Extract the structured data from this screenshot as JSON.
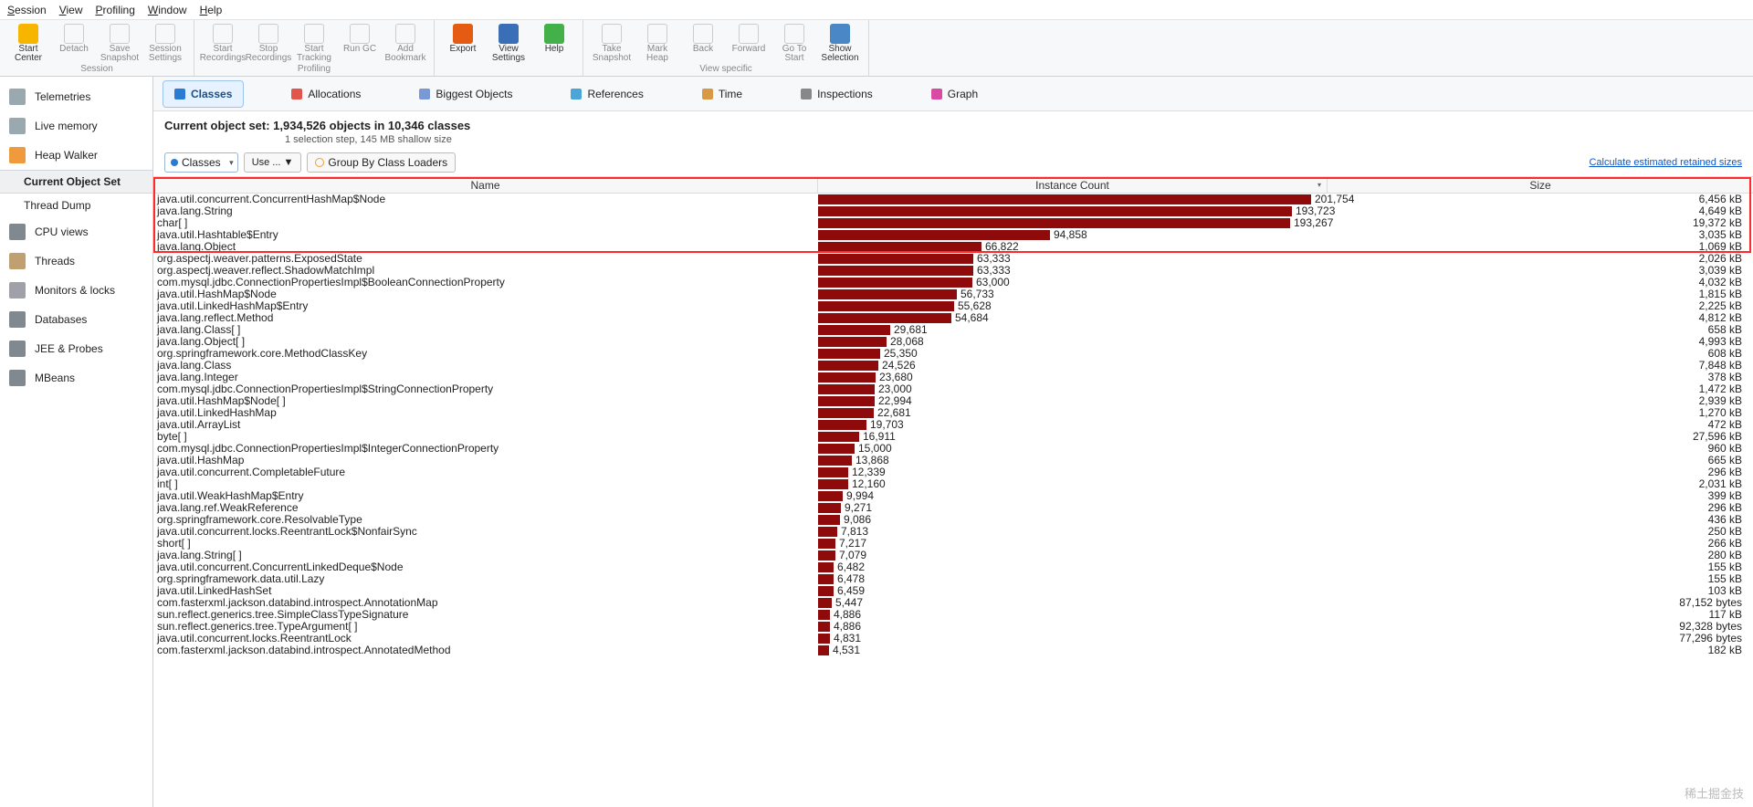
{
  "menu": [
    "Session",
    "View",
    "Profiling",
    "Window",
    "Help"
  ],
  "toolbar_groups": [
    {
      "label": "Session",
      "items": [
        {
          "label": "Start\nCenter",
          "enabled": true,
          "color": "#f7b500"
        },
        {
          "label": "Detach",
          "enabled": false
        },
        {
          "label": "Save\nSnapshot",
          "enabled": false
        },
        {
          "label": "Session\nSettings",
          "enabled": false
        }
      ]
    },
    {
      "label": "Profiling",
      "items": [
        {
          "label": "Start\nRecordings",
          "enabled": false
        },
        {
          "label": "Stop\nRecordings",
          "enabled": false
        },
        {
          "label": "Start\nTracking",
          "enabled": false
        },
        {
          "label": "Run GC",
          "enabled": false
        },
        {
          "label": "Add\nBookmark",
          "enabled": false
        }
      ]
    },
    {
      "label": "",
      "items": [
        {
          "label": "Export",
          "enabled": true,
          "color": "#e55b13"
        },
        {
          "label": "View\nSettings",
          "enabled": true,
          "color": "#3a6fb7"
        },
        {
          "label": "Help",
          "enabled": true,
          "color": "#44b04a"
        }
      ]
    },
    {
      "label": "View specific",
      "items": [
        {
          "label": "Take\nSnapshot",
          "enabled": false
        },
        {
          "label": "Mark\nHeap",
          "enabled": false
        },
        {
          "label": "Back",
          "enabled": false
        },
        {
          "label": "Forward",
          "enabled": false
        },
        {
          "label": "Go To\nStart",
          "enabled": false
        },
        {
          "label": "Show\nSelection",
          "enabled": true,
          "color": "#4987c7"
        }
      ]
    }
  ],
  "sidebar": [
    {
      "label": "Telemetries",
      "ic": "#9aa8b0"
    },
    {
      "label": "Live memory",
      "ic": "#9aa8b0"
    },
    {
      "label": "Heap Walker",
      "ic": "#f09a3e"
    },
    {
      "label": "Current Object Set",
      "sub": true,
      "sel": true
    },
    {
      "label": "Thread Dump",
      "sub": true
    },
    {
      "label": "CPU views",
      "ic": "#808890"
    },
    {
      "label": "Threads",
      "ic": "#c0a070"
    },
    {
      "label": "Monitors & locks",
      "ic": "#a0a0a8"
    },
    {
      "label": "Databases",
      "ic": "#808890"
    },
    {
      "label": "JEE & Probes",
      "ic": "#808890"
    },
    {
      "label": "MBeans",
      "ic": "#808890"
    }
  ],
  "tabs": [
    {
      "label": "Classes",
      "sel": true,
      "color": "#2a7bd4"
    },
    {
      "label": "Allocations",
      "color": "#e2554d"
    },
    {
      "label": "Biggest Objects",
      "color": "#7a97d6"
    },
    {
      "label": "References",
      "color": "#4aa6d6"
    },
    {
      "label": "Time",
      "color": "#d69a45"
    },
    {
      "label": "Inspections",
      "color": "#888"
    },
    {
      "label": "Graph",
      "color": "#d94aa2"
    }
  ],
  "header": {
    "title": "Current object set:  1,934,526 objects in 10,346 classes",
    "sub": "1 selection step, 145 MB shallow size"
  },
  "controls": {
    "combo1": "Classes",
    "btn1": "Use ... ▼",
    "btn2": "Group By Class Loaders",
    "link": "Calculate estimated retained sizes"
  },
  "columns": {
    "c1": "Name",
    "c2": "Instance Count",
    "c3": "Size"
  },
  "max_count": 201754,
  "rows": [
    {
      "name": "java.util.concurrent.ConcurrentHashMap$Node",
      "count": 201754,
      "size": "6,456 kB"
    },
    {
      "name": "java.lang.String",
      "count": 193723,
      "size": "4,649 kB"
    },
    {
      "name": "char[ ]",
      "count": 193267,
      "size": "19,372 kB"
    },
    {
      "name": "java.util.Hashtable$Entry",
      "count": 94858,
      "size": "3,035 kB"
    },
    {
      "name": "java.lang.Object",
      "count": 66822,
      "size": "1,069 kB"
    },
    {
      "name": "org.aspectj.weaver.patterns.ExposedState",
      "count": 63333,
      "size": "2,026 kB"
    },
    {
      "name": "org.aspectj.weaver.reflect.ShadowMatchImpl",
      "count": 63333,
      "size": "3,039 kB"
    },
    {
      "name": "com.mysql.jdbc.ConnectionPropertiesImpl$BooleanConnectionProperty",
      "count": 63000,
      "size": "4,032 kB"
    },
    {
      "name": "java.util.HashMap$Node",
      "count": 56733,
      "size": "1,815 kB"
    },
    {
      "name": "java.util.LinkedHashMap$Entry",
      "count": 55628,
      "size": "2,225 kB"
    },
    {
      "name": "java.lang.reflect.Method",
      "count": 54684,
      "size": "4,812 kB"
    },
    {
      "name": "java.lang.Class[ ]",
      "count": 29681,
      "size": "658 kB"
    },
    {
      "name": "java.lang.Object[ ]",
      "count": 28068,
      "size": "4,993 kB"
    },
    {
      "name": "org.springframework.core.MethodClassKey",
      "count": 25350,
      "size": "608 kB"
    },
    {
      "name": "java.lang.Class",
      "count": 24526,
      "size": "7,848 kB"
    },
    {
      "name": "java.lang.Integer",
      "count": 23680,
      "size": "378 kB"
    },
    {
      "name": "com.mysql.jdbc.ConnectionPropertiesImpl$StringConnectionProperty",
      "count": 23000,
      "size": "1,472 kB"
    },
    {
      "name": "java.util.HashMap$Node[ ]",
      "count": 22994,
      "size": "2,939 kB"
    },
    {
      "name": "java.util.LinkedHashMap",
      "count": 22681,
      "size": "1,270 kB"
    },
    {
      "name": "java.util.ArrayList",
      "count": 19703,
      "size": "472 kB"
    },
    {
      "name": "byte[ ]",
      "count": 16911,
      "size": "27,596 kB"
    },
    {
      "name": "com.mysql.jdbc.ConnectionPropertiesImpl$IntegerConnectionProperty",
      "count": 15000,
      "size": "960 kB"
    },
    {
      "name": "java.util.HashMap",
      "count": 13868,
      "size": "665 kB"
    },
    {
      "name": "java.util.concurrent.CompletableFuture",
      "count": 12339,
      "size": "296 kB"
    },
    {
      "name": "int[ ]",
      "count": 12160,
      "size": "2,031 kB"
    },
    {
      "name": "java.util.WeakHashMap$Entry",
      "count": 9994,
      "size": "399 kB"
    },
    {
      "name": "java.lang.ref.WeakReference",
      "count": 9271,
      "size": "296 kB"
    },
    {
      "name": "org.springframework.core.ResolvableType",
      "count": 9086,
      "size": "436 kB"
    },
    {
      "name": "java.util.concurrent.locks.ReentrantLock$NonfairSync",
      "count": 7813,
      "size": "250 kB"
    },
    {
      "name": "short[ ]",
      "count": 7217,
      "size": "266 kB"
    },
    {
      "name": "java.lang.String[ ]",
      "count": 7079,
      "size": "280 kB"
    },
    {
      "name": "java.util.concurrent.ConcurrentLinkedDeque$Node",
      "count": 6482,
      "size": "155 kB"
    },
    {
      "name": "org.springframework.data.util.Lazy",
      "count": 6478,
      "size": "155 kB"
    },
    {
      "name": "java.util.LinkedHashSet",
      "count": 6459,
      "size": "103 kB"
    },
    {
      "name": "com.fasterxml.jackson.databind.introspect.AnnotationMap",
      "count": 5447,
      "size": "87,152 bytes"
    },
    {
      "name": "sun.reflect.generics.tree.SimpleClassTypeSignature",
      "count": 4886,
      "size": "117 kB"
    },
    {
      "name": "sun.reflect.generics.tree.TypeArgument[ ]",
      "count": 4886,
      "size": "92,328 bytes"
    },
    {
      "name": "java.util.concurrent.locks.ReentrantLock",
      "count": 4831,
      "size": "77,296 bytes"
    },
    {
      "name": "com.fasterxml.jackson.databind.introspect.AnnotatedMethod",
      "count": 4531,
      "size": "182 kB"
    }
  ],
  "watermark": "稀土掘金技"
}
